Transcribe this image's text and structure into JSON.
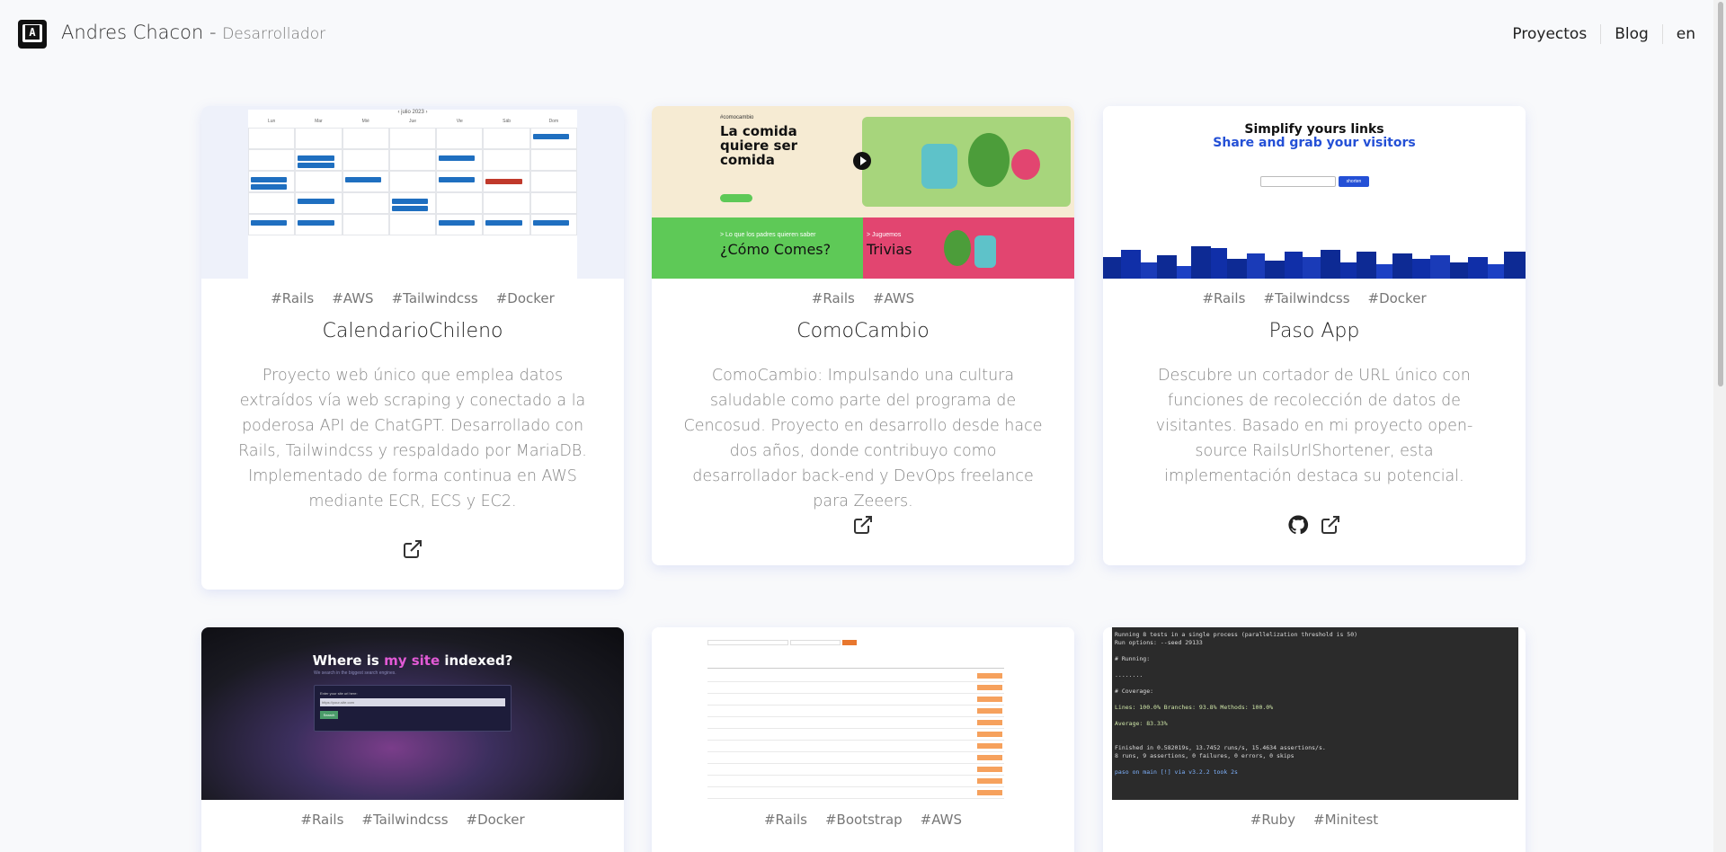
{
  "header": {
    "name": "Andres Chacon",
    "separator": " - ",
    "role": "Desarrollador",
    "nav": [
      "Proyectos",
      "Blog",
      "en"
    ]
  },
  "projects": [
    {
      "tags": [
        "#Rails",
        "#AWS",
        "#Tailwindcss",
        "#Docker"
      ],
      "title": "CalendarioChileno",
      "description": "Proyecto web único que emplea datos extraídos vía web scraping y conectado a la poderosa API de ChatGPT. Desarrollado con Rails, Tailwindcss y respaldado por MariaDB. Implementado de forma continua en AWS mediante ECR, ECS y EC2.",
      "links": [
        "external-link-icon"
      ],
      "thumbnail": {
        "month": "julio 2023",
        "days": [
          "Lun",
          "Mar",
          "Mié",
          "Jue",
          "Vie",
          "Sáb",
          "Dom"
        ]
      }
    },
    {
      "tags": [
        "#Rails",
        "#AWS"
      ],
      "title": "ComoCambio",
      "description": "ComoCambio: Impulsando una cultura saludable como parte del programa de Cencosud. Proyecto en desarrollo desde hace dos años, donde contribuyo como desarrollador back-end y DevOps freelance para Zeeers.",
      "links": [
        "external-link-icon"
      ],
      "thumbnail": {
        "hashtag": "#comocambio",
        "headline": "La comida quiere ser comida",
        "green_kicker": "> Lo que los padres quieren saber",
        "green_title": "¿Cómo Comes?",
        "pink_kicker": "> Juguemos",
        "pink_title": "Trivias"
      }
    },
    {
      "tags": [
        "#Rails",
        "#Tailwindcss",
        "#Docker"
      ],
      "title": "Paso App",
      "description": "Descubre un cortador de URL único con funciones de recolección de datos de visitantes. Basado en mi proyecto open-source RailsUrlShortener, esta implementación destaca su potencial.",
      "links": [
        "github-icon",
        "external-link-icon"
      ],
      "thumbnail": {
        "title": "Simplify yours links",
        "subtitle": "Share and grab your visitors",
        "button": "shorten"
      }
    },
    {
      "tags": [
        "#Rails",
        "#Tailwindcss",
        "#Docker"
      ],
      "thumbnail": {
        "title_pre": "Where is ",
        "title_my": "my",
        "title_site": " site",
        "title_post": " indexed?",
        "subtitle": "We search in the biggest search engines.",
        "field_label": "Enter your site url here:",
        "placeholder": "https://your-site.com",
        "button": "Search"
      }
    },
    {
      "tags": [
        "#Rails",
        "#Bootstrap",
        "#AWS"
      ]
    },
    {
      "tags": [
        "#Ruby",
        "#Minitest"
      ],
      "thumbnail": {
        "lines": [
          "Running 8 tests in a single process (parallelization threshold is 50)",
          "Run options: --seed 29133",
          "",
          "# Running:",
          "",
          "........",
          "",
          "# Coverage:",
          "",
          "Lines: 100.0%   Branches: 93.8% Methods: 100.0%",
          "",
          "Average: 83.33%",
          "",
          "",
          "Finished in 0.582019s, 13.7452 runs/s, 15.4634 assertions/s.",
          "8 runs, 9 assertions, 0 failures, 0 errors, 0 skips",
          "",
          "paso on main [!] via v3.2.2 took 2s"
        ]
      }
    }
  ]
}
